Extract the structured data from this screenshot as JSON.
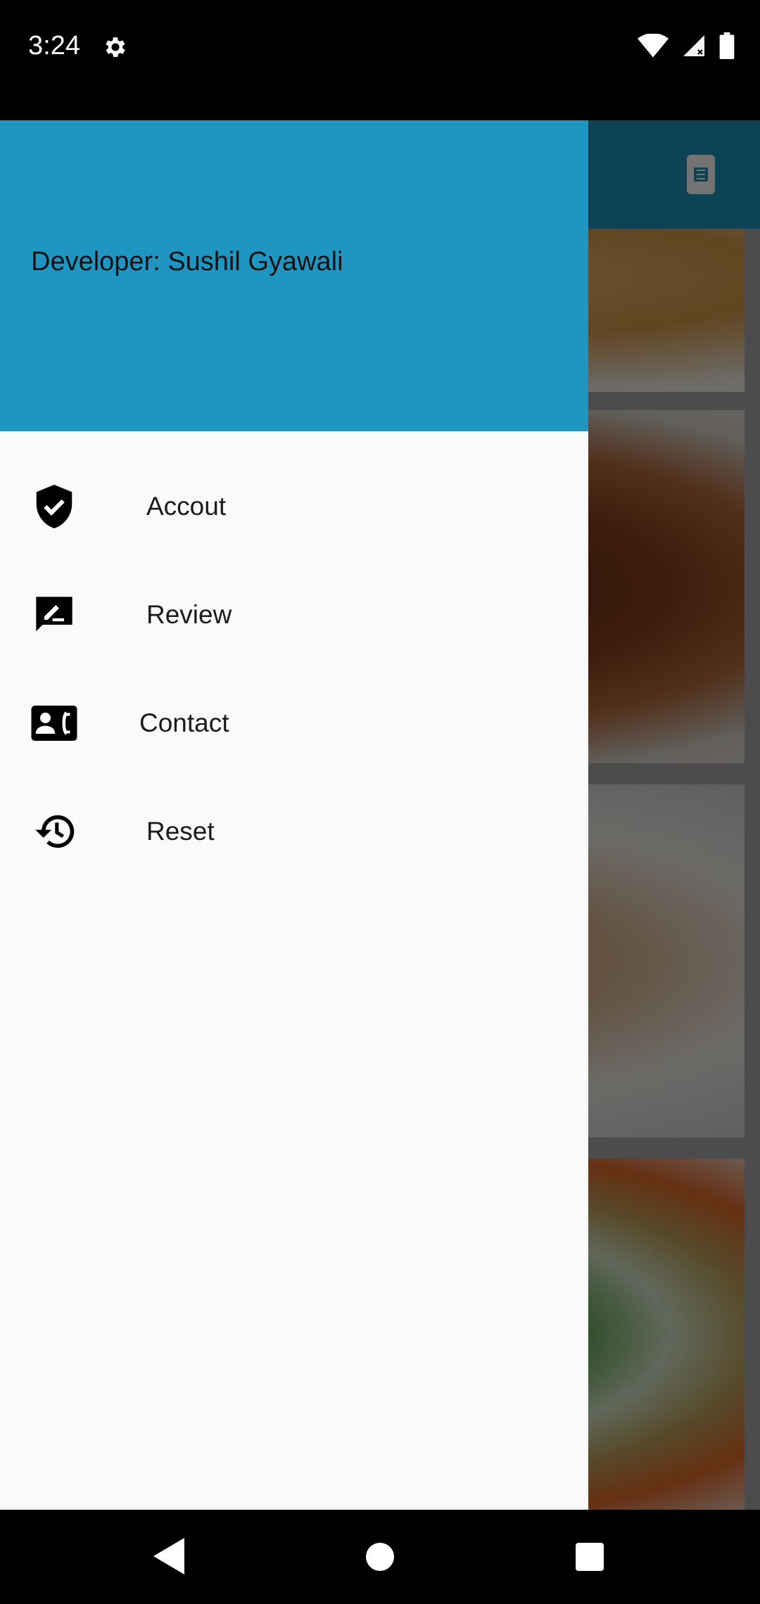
{
  "status_bar": {
    "time": "3:24",
    "icons": [
      "gear-icon",
      "wifi-icon",
      "signal-icon",
      "battery-icon"
    ]
  },
  "drawer": {
    "header_text": "Developer: Sushil Gyawali",
    "header_color": "#1f96c1",
    "items": [
      {
        "label": "Accout",
        "icon": "shield-check-icon"
      },
      {
        "label": "Review",
        "icon": "rate-review-icon"
      },
      {
        "label": "Contact",
        "icon": "contact-phone-icon"
      },
      {
        "label": "Reset",
        "icon": "history-icon"
      }
    ]
  },
  "background_app": {
    "appbar_icon": "calculator-icon",
    "cards": [
      "food-image-pastry",
      "food-image-pie",
      "food-image-pasta",
      "food-image-salad"
    ]
  },
  "nav_bar": {
    "icons": [
      "back-icon",
      "home-icon",
      "recents-icon"
    ]
  }
}
